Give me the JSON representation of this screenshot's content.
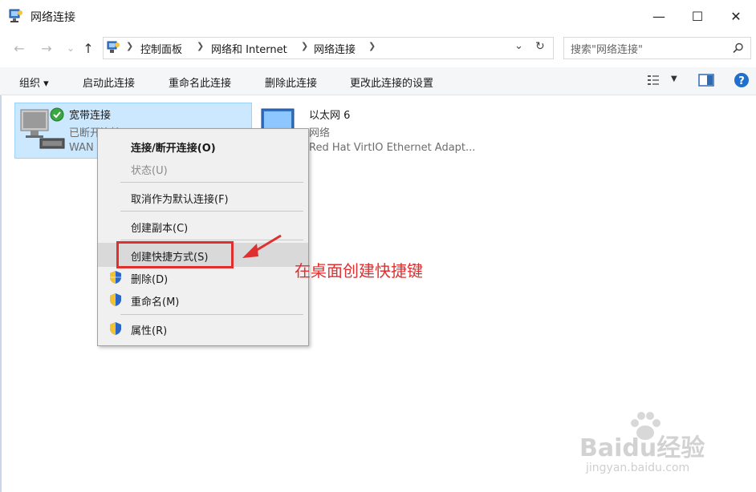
{
  "window": {
    "title": "网络连接",
    "minimize": "—",
    "maximize": "☐",
    "close": "✕"
  },
  "nav": {
    "back": "←",
    "forward": "→",
    "recent": "⌄",
    "up": "↑"
  },
  "breadcrumbs": [
    "控制面板",
    "网络和 Internet",
    "网络连接"
  ],
  "search": {
    "placeholder": "搜索\"网络连接\""
  },
  "commandbar": {
    "organize": "组织 ▾",
    "start": "启动此连接",
    "rename": "重命名此连接",
    "delete": "删除此连接",
    "change": "更改此连接的设置"
  },
  "items": [
    {
      "name": "宽带连接",
      "status": "已断开连接",
      "device": "WAN Miniport (PPPOE)"
    },
    {
      "name": "以太网 6",
      "status": "网络",
      "device": "Red Hat VirtIO Ethernet Adapt..."
    }
  ],
  "context_menu": {
    "connect": "连接/断开连接(O)",
    "status": "状态(U)",
    "cancel_default": "取消作为默认连接(F)",
    "copy": "创建副本(C)",
    "shortcut": "创建快捷方式(S)",
    "delete": "删除(D)",
    "rename": "重命名(M)",
    "properties": "属性(R)"
  },
  "annotation": {
    "text": "在桌面创建快捷键"
  },
  "watermark": {
    "brand": "Baidu经验",
    "url": "jingyan.baidu.com"
  },
  "colors": {
    "accent": "#0067c0",
    "highlight": "#cce8ff",
    "annotation": "#e02f2f"
  }
}
